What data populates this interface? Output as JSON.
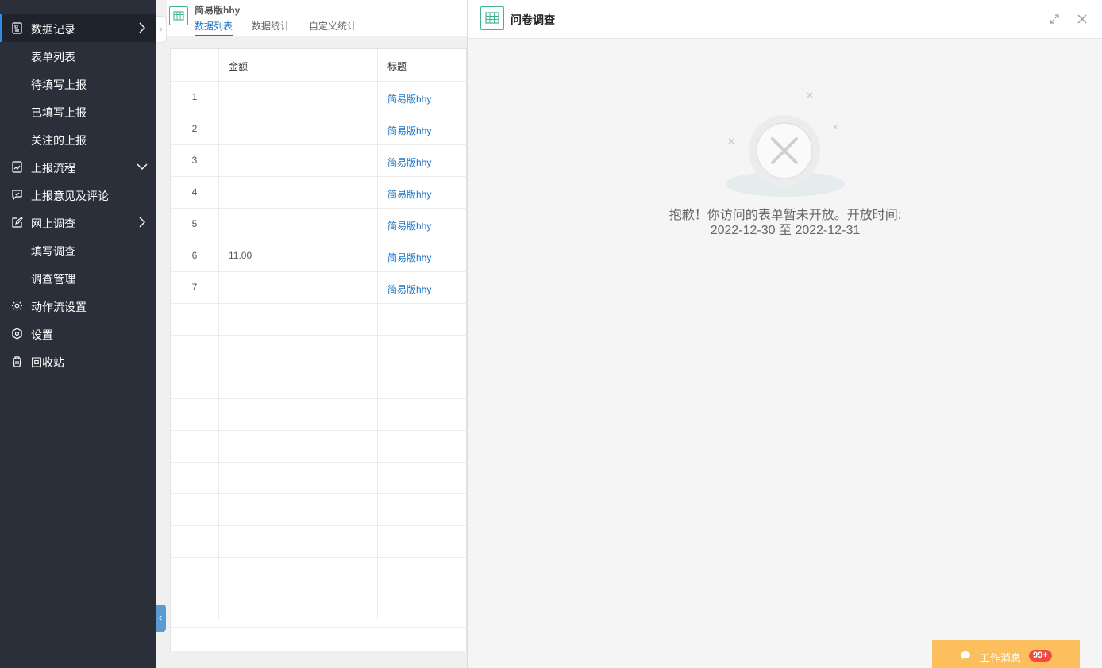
{
  "sidebar": {
    "items": [
      {
        "label": "数据记录",
        "icon": "document-icon",
        "arrow": "chevron-right"
      },
      {
        "label": "表单列表"
      },
      {
        "label": "待填写上报"
      },
      {
        "label": "已填写上报"
      },
      {
        "label": "关注的上报"
      },
      {
        "label": "上报流程",
        "icon": "flow-doc-icon",
        "arrow": "chevron-down"
      },
      {
        "label": "上报意见及评论",
        "icon": "comment-icon"
      },
      {
        "label": "网上调查",
        "icon": "edit-icon",
        "arrow": "chevron-right"
      },
      {
        "label": "填写调查"
      },
      {
        "label": "调查管理"
      },
      {
        "label": "动作流设置",
        "icon": "gear-icon"
      },
      {
        "label": "设置",
        "icon": "hexagon-settings-icon"
      },
      {
        "label": "回收站",
        "icon": "trash-icon"
      }
    ]
  },
  "main": {
    "form_title": "简易版hhy",
    "tabs": [
      "数据列表",
      "数据统计",
      "自定义统计"
    ],
    "columns": [
      "",
      "金额",
      "标题"
    ],
    "rows": [
      {
        "num": "1",
        "amount": "",
        "title": "简易版hhy"
      },
      {
        "num": "2",
        "amount": "",
        "title": "简易版hhy"
      },
      {
        "num": "3",
        "amount": "",
        "title": "简易版hhy"
      },
      {
        "num": "4",
        "amount": "",
        "title": "简易版hhy"
      },
      {
        "num": "5",
        "amount": "",
        "title": "简易版hhy"
      },
      {
        "num": "6",
        "amount": "11.00",
        "title": "简易版hhy"
      },
      {
        "num": "7",
        "amount": "",
        "title": "简易版hhy"
      }
    ]
  },
  "panel": {
    "title": "问卷调查",
    "message_line1": "抱歉！你访问的表单暂未开放。开放时间:",
    "message_line2": "2022-12-30 至 2022-12-31"
  },
  "work_message": {
    "label": "工作消息",
    "badge": "99+"
  },
  "colors": {
    "sidebar_bg": "#2b2f3a",
    "accent": "#1a73c6",
    "icon_green": "#3fb58e",
    "work_msg_bg": "#fbbf5e",
    "badge_red": "#f5493f"
  }
}
